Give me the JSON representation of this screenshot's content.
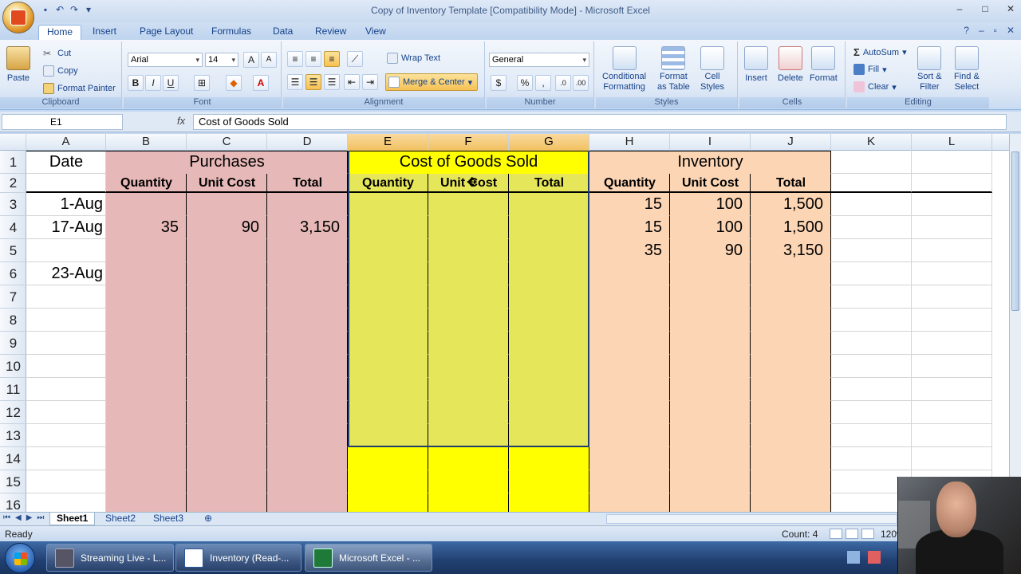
{
  "window": {
    "title": "Copy of Inventory Template  [Compatibility Mode] - Microsoft Excel"
  },
  "ribbon": {
    "tabs": [
      "Home",
      "Insert",
      "Page Layout",
      "Formulas",
      "Data",
      "Review",
      "View"
    ],
    "clipboard": {
      "paste": "Paste",
      "cut": "Cut",
      "copy": "Copy",
      "format_painter": "Format Painter",
      "label": "Clipboard"
    },
    "font": {
      "name": "Arial",
      "size": "14",
      "label": "Font",
      "bold": "B",
      "italic": "I",
      "underline": "U"
    },
    "alignment": {
      "wrap_text": "Wrap Text",
      "merge_center": "Merge & Center",
      "label": "Alignment"
    },
    "number": {
      "format": "General",
      "currency": "$",
      "percent": "%",
      "comma": ",",
      "label": "Number"
    },
    "styles": {
      "conditional": "Conditional",
      "conditional2": "Formatting",
      "format_table": "Format",
      "format_table2": "as Table",
      "cell_styles": "Cell",
      "cell_styles2": "Styles",
      "label": "Styles"
    },
    "cells": {
      "insert": "Insert",
      "delete": "Delete",
      "format": "Format",
      "label": "Cells"
    },
    "editing": {
      "autosum": "AutoSum",
      "fill": "Fill",
      "clear": "Clear",
      "sort": "Sort &",
      "sort2": "Filter",
      "find": "Find &",
      "find2": "Select",
      "label": "Editing"
    }
  },
  "formula_bar": {
    "name_box": "E1",
    "fx": "fx",
    "content": "Cost of Goods Sold"
  },
  "columns": [
    "A",
    "B",
    "C",
    "D",
    "E",
    "F",
    "G",
    "H",
    "I",
    "J",
    "K",
    "L"
  ],
  "rows": [
    "1",
    "2",
    "3",
    "4",
    "5",
    "6",
    "7",
    "8",
    "9",
    "10",
    "11",
    "12",
    "13",
    "14",
    "15",
    "16"
  ],
  "sheet": {
    "a1": "Date",
    "purchases": "Purchases",
    "cogs": "Cost of Goods Sold",
    "inventory": "Inventory",
    "sub_headers": [
      "Quantity",
      "Unit Cost",
      "Total",
      "Quantity",
      "Unit Cost",
      "Total",
      "Quantity",
      "Unit Cost",
      "Total"
    ],
    "dates": {
      "r3": "1-Aug",
      "r4": "17-Aug",
      "r6": "23-Aug"
    },
    "purchases_row4": [
      "35",
      "90",
      "3,150"
    ],
    "inventory_rows": [
      [
        "15",
        "100",
        "1,500"
      ],
      [
        "15",
        "100",
        "1,500"
      ],
      [
        "35",
        "90",
        "3,150"
      ]
    ]
  },
  "sheet_tabs": [
    "Sheet1",
    "Sheet2",
    "Sheet3"
  ],
  "status": {
    "ready": "Ready",
    "count": "Count: 4",
    "zoom": "120%"
  },
  "taskbar": [
    {
      "label": "Streaming Live - L..."
    },
    {
      "label": "Inventory (Read-..."
    },
    {
      "label": "Microsoft Excel - ..."
    }
  ],
  "colors": {
    "pink": "#e6b8b7",
    "yellow_sel": "#e6e65a",
    "yellow": "#ffff00",
    "peach": "#fcd5b4",
    "selected_header": "#f4c669"
  }
}
